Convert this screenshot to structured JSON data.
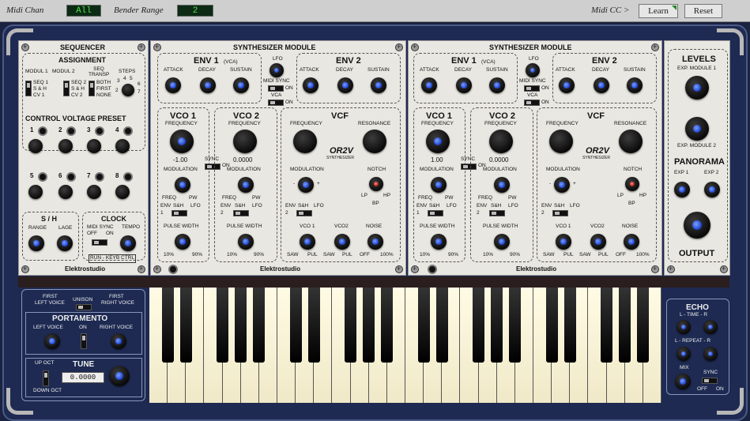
{
  "topbar": {
    "midi_chan_label": "Midi Chan",
    "midi_chan_value": "All",
    "bender_label": "Bender Range",
    "bender_value": "2",
    "midi_cc_label": "Midi CC >",
    "learn": "Learn",
    "reset": "Reset"
  },
  "sequencer": {
    "title": "SEQUENCER",
    "assignment": "ASSIGNMENT",
    "modul1": "MODUL 1",
    "modul2": "MODUL 2",
    "seq_transp": "SEQ TRANSP",
    "steps": "STEPS",
    "seq1": "SEQ 1",
    "sh1": "S & H",
    "cv1": "CV 1",
    "seq2": "SEQ 2",
    "sh2": "S & H",
    "cv2": "CV 2",
    "both": "BOTH",
    "first": "FIRST",
    "none": "NONE",
    "steps_nums": [
      "3",
      "4",
      "5",
      "6",
      "2",
      "7"
    ],
    "cv_preset": "CONTROL VOLTAGE PRESET",
    "nums": [
      "1",
      "2",
      "3",
      "4",
      "5",
      "6",
      "7",
      "8"
    ],
    "sh": "S / H",
    "range": "RANGE",
    "lage": "LAGE",
    "clock": "CLOCK",
    "midi_sync": "MIDI SYNC",
    "off": "OFF",
    "on": "ON",
    "tempo": "TEMPO",
    "run_keyb": "RUN - KEYB CTRL",
    "brand": "Elektrostudio"
  },
  "synth": [
    {
      "title": "SYNTHESIZER MODULE",
      "env1": "ENV 1",
      "vca_tag": "(VCA)",
      "attack": "ATTACK",
      "decay": "DECAY",
      "sustain": "SUSTAIN",
      "lfo": "LFO",
      "midi_sync": "MIDI SYNC",
      "on": "ON",
      "vca": "VCA",
      "env2": "ENV 2",
      "vco1": "VCO 1",
      "vco2": "VCO 2",
      "frequency": "FREQUENCY",
      "vco1_val": "-1.00",
      "vco2_val": "0.0000",
      "sync": "SYNC",
      "modulation": "MODULATION",
      "freq": "FREQ",
      "pw": "PW",
      "env": "ENV",
      "sh": "S&H",
      "lfo2": "LFO",
      "one": "1",
      "two": "2",
      "pulse_width": "PULSE WIDTH",
      "p10": "10%",
      "p90": "90%",
      "vcf": "VCF",
      "resonance": "RESONANCE",
      "or2v": "OR2V",
      "synthesizer": "SYNTHESIZER",
      "minus": "-",
      "plus": "+",
      "notch": "NOTCH",
      "lp": "LP",
      "hp": "HP",
      "bp": "BP",
      "vco1b": "VCO 1",
      "vco2b": "VCO2",
      "noise": "NOISE",
      "saw": "SAW",
      "pul": "PUL",
      "off": "OFF",
      "p100": "100%",
      "brand": "Elektrostudio"
    },
    {
      "title": "SYNTHESIZER MODULE",
      "env1": "ENV 1",
      "vca_tag": "(VCA)",
      "attack": "ATTACK",
      "decay": "DECAY",
      "sustain": "SUSTAIN",
      "lfo": "LFO",
      "midi_sync": "MIDI SYNC",
      "on": "ON",
      "vca": "VCA",
      "env2": "ENV 2",
      "vco1": "VCO 1",
      "vco2": "VCO 2",
      "frequency": "FREQUENCY",
      "vco1_val": "1.00",
      "vco2_val": "0.0000",
      "sync": "SYNC",
      "modulation": "MODULATION",
      "freq": "FREQ",
      "pw": "PW",
      "env": "ENV",
      "sh": "S&H",
      "lfo2": "LFO",
      "one": "1",
      "two": "2",
      "pulse_width": "PULSE WIDTH",
      "p10": "10%",
      "p90": "90%",
      "vcf": "VCF",
      "resonance": "RESONANCE",
      "or2v": "OR2V",
      "synthesizer": "SYNTHESIZER",
      "minus": "-",
      "plus": "+",
      "notch": "NOTCH",
      "lp": "LP",
      "hp": "HP",
      "bp": "BP",
      "vco1b": "VCO 1",
      "vco2b": "VCO2",
      "noise": "NOISE",
      "saw": "SAW",
      "pul": "PUL",
      "off": "OFF",
      "p100": "100%",
      "brand": "Elektrostudio"
    }
  ],
  "levels": {
    "title": "LEVELS",
    "exp_module1": "EXP. MODULE 1",
    "exp_module2": "EXP. MODULE 2",
    "panorama": "PANORAMA",
    "exp1": "EXP 1",
    "exp2": "EXP 2",
    "output": "OUTPUT"
  },
  "voice": {
    "first_left": "FIRST",
    "left_voice": "LEFT VOICE",
    "unison": "UNISON",
    "first_right": "FIRST",
    "right_voice": "RIGHT VOICE",
    "portamento": "PORTAMENTO",
    "p_left": "LEFT VOICE",
    "p_on": "ON",
    "p_right": "RIGHT VOICE",
    "up_oct": "UP OCT",
    "tune": "TUNE",
    "tune_val": "0.0000",
    "down_oct": "DOWN OCT"
  },
  "echo": {
    "title": "ECHO",
    "time": "L - TIME - R",
    "repeat": "L - REPEAT - R",
    "mix": "MIX",
    "sync": "SYNC",
    "off": "OFF",
    "on": "ON"
  }
}
